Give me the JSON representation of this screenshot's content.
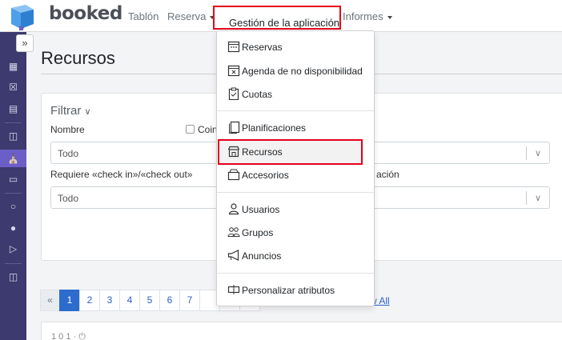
{
  "brand": {
    "name": "booked",
    "accent": "#4fa0ea",
    "sidebar_color": "#3c3a6e",
    "highlight_color": "#e3001b"
  },
  "nav": {
    "items": [
      {
        "label": "Tablón",
        "caret": false
      },
      {
        "label": "Reserva",
        "caret": true
      },
      {
        "label": "Gestión de la aplicación",
        "caret": true
      },
      {
        "label": "Informes",
        "caret": true
      }
    ]
  },
  "sidebar": {
    "toggle": "»",
    "icons": [
      "calendar-icon",
      "calendar-x-icon",
      "clipboard-icon",
      "document-stack-icon",
      "store-icon",
      "box-icon",
      "user-icon",
      "users-icon",
      "megaphone-icon",
      "attributes-icon"
    ]
  },
  "page": {
    "title": "Recursos"
  },
  "filter": {
    "title": "Filtrar",
    "name_label": "Nombre",
    "checkbox_label": "Coin",
    "name_value": "Todo",
    "checkin_label": "Requiere «check in»/«check out»",
    "checkin_value": "Todo",
    "right_label": "ación"
  },
  "pagination": {
    "prev": "«",
    "pages": [
      "1",
      "2",
      "3",
      "4",
      "5",
      "6",
      "7"
    ],
    "current": "1",
    "view_all": "w All"
  },
  "bottom": {
    "text": "1 0 1 · ⏻"
  },
  "dropdown": {
    "items": [
      {
        "label": "Reservas",
        "icon": "calendar-dots-icon"
      },
      {
        "label": "Agenda de no disponibilidad",
        "icon": "calendar-x-icon"
      },
      {
        "label": "Cuotas",
        "icon": "clipboard-check-icon"
      },
      {
        "label": "Planificaciones",
        "icon": "stacked-pages-icon"
      },
      {
        "label": "Recursos",
        "icon": "store-icon"
      },
      {
        "label": "Accesorios",
        "icon": "box-icon"
      },
      {
        "label": "Usuarios",
        "icon": "user-icon"
      },
      {
        "label": "Grupos",
        "icon": "users-icon"
      },
      {
        "label": "Anuncios",
        "icon": "megaphone-icon"
      },
      {
        "label": "Personalizar atributos",
        "icon": "attributes-icon"
      }
    ]
  }
}
